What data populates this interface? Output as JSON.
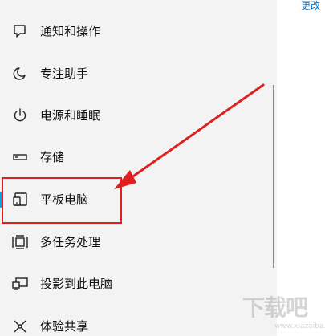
{
  "header": {
    "change_link": "更改"
  },
  "nav": {
    "items": [
      {
        "label": "通知和操作",
        "icon": "notification-icon"
      },
      {
        "label": "专注助手",
        "icon": "moon-icon"
      },
      {
        "label": "电源和睡眠",
        "icon": "power-icon"
      },
      {
        "label": "存储",
        "icon": "storage-icon"
      },
      {
        "label": "平板电脑",
        "icon": "tablet-icon",
        "selected": true
      },
      {
        "label": "多任务处理",
        "icon": "multitasking-icon"
      },
      {
        "label": "投影到此电脑",
        "icon": "projecting-icon"
      },
      {
        "label": "体验共享",
        "icon": "share-icon"
      }
    ]
  },
  "watermark": {
    "text": "下载吧",
    "url": "www.xiazaiba.com"
  },
  "colors": {
    "accent": "#00a4ef",
    "link": "#0078d7",
    "annotation_red": "#e02020"
  }
}
